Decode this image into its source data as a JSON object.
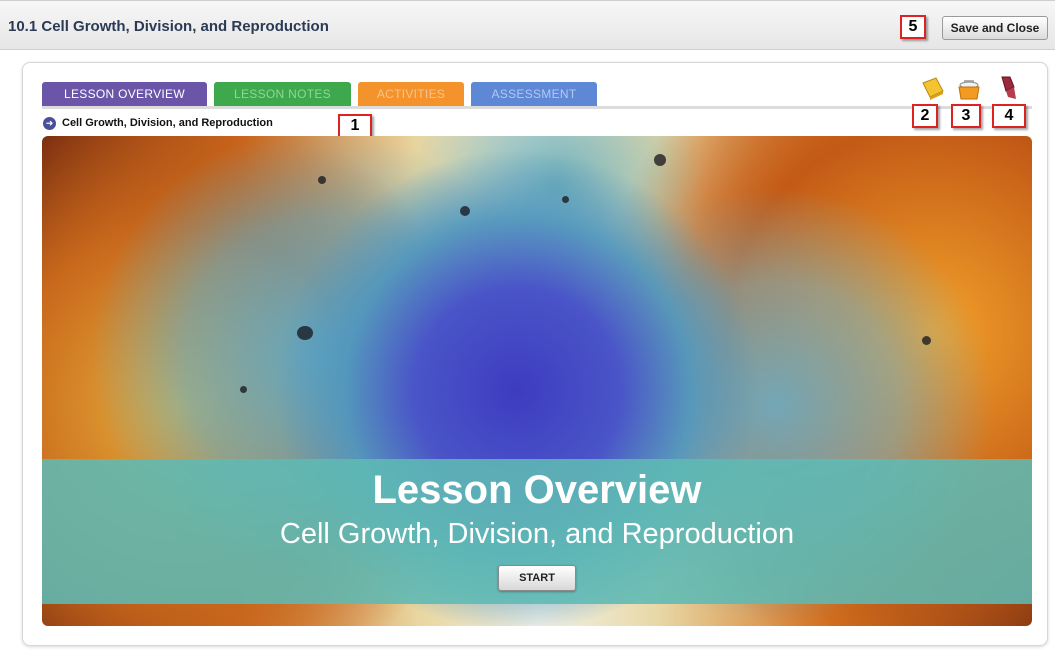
{
  "header": {
    "title": "10.1 Cell Growth, Division, and Reproduction",
    "save_close_label": "Save and Close"
  },
  "tabs": [
    {
      "label": "LESSON OVERVIEW",
      "active": true,
      "color": "#6a55a8"
    },
    {
      "label": "LESSON NOTES",
      "active": false,
      "color": "#3ea84c"
    },
    {
      "label": "ACTIVITIES",
      "active": false,
      "color": "#f4922b"
    },
    {
      "label": "ASSESSMENT",
      "active": false,
      "color": "#5e88d6"
    }
  ],
  "breadcrumb": {
    "text": "Cell Growth, Division, and Reproduction"
  },
  "toolbar_icons": [
    "notebook-icon",
    "basket-icon",
    "highlighter-icon"
  ],
  "hero": {
    "title": "Lesson Overview",
    "subtitle": "Cell Growth, Division, and Reproduction",
    "start_label": "START"
  },
  "callouts": [
    "1",
    "2",
    "3",
    "4",
    "5"
  ]
}
